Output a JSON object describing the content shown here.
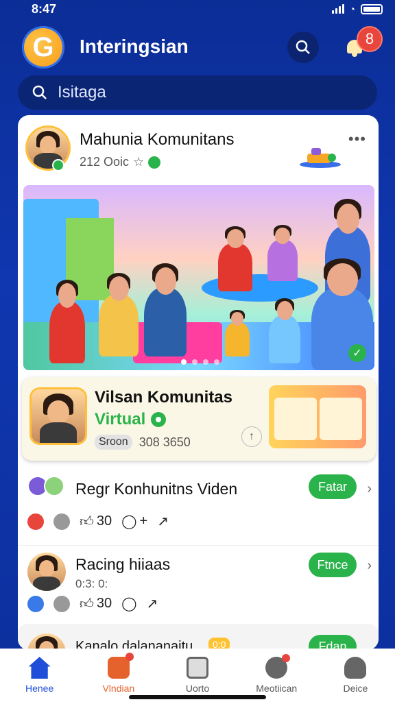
{
  "status": {
    "time": "8:47"
  },
  "header": {
    "logo_letter": "G",
    "title": "Interingsian",
    "notification_count": "8"
  },
  "search": {
    "placeholder": "Isitaga"
  },
  "post": {
    "title": "Mahunia Komunitans",
    "meta": "212 Ooic",
    "more_label": "•••"
  },
  "live": {
    "title": "Vilsan Komunitas",
    "virtual_label": "Virtual",
    "pill": "Sroon",
    "count": "308 3650"
  },
  "rows": [
    {
      "title": "Regr Konhunitns Viden",
      "button": "Fatar",
      "stat1": "30",
      "stat2": "+"
    },
    {
      "title": "Racing hiiaas",
      "meta": "0:3: 0:",
      "button": "Ftnce",
      "stat1": "30",
      "stat2": ""
    }
  ],
  "peek": {
    "title": "Kanalo dalananaitu",
    "tag": "0:0",
    "button": "Fdan"
  },
  "nav": [
    {
      "label": "Henee"
    },
    {
      "label": "Vlndian"
    },
    {
      "label": "Uorto"
    },
    {
      "label": "Meotiican"
    },
    {
      "label": "Deice"
    }
  ],
  "colors": {
    "brand_blue": "#1037b0",
    "accent_green": "#2bb34b",
    "badge_red": "#e8453c",
    "accent_orange": "#e6622c"
  }
}
